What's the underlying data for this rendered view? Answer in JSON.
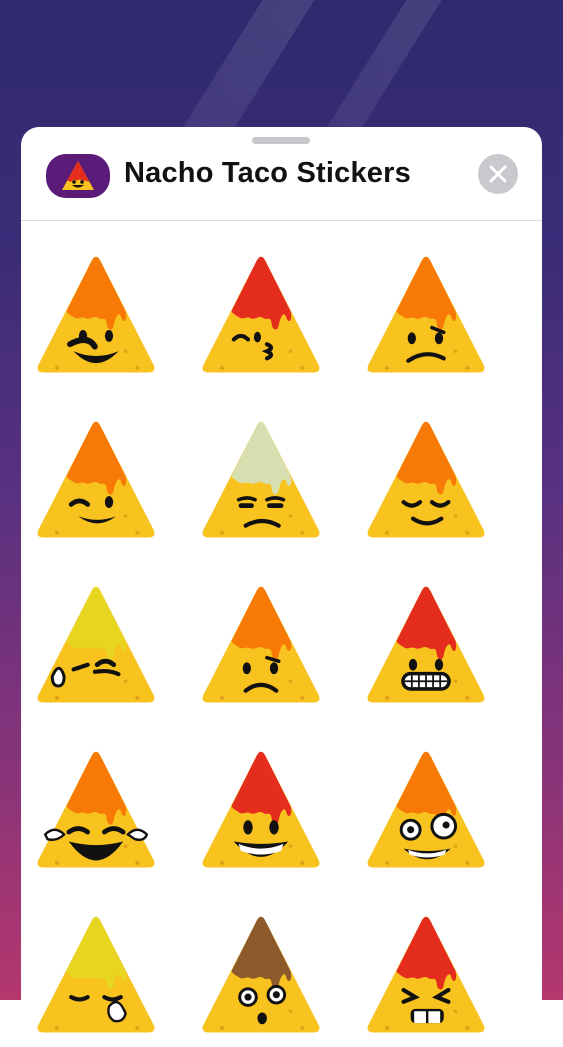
{
  "sheet": {
    "title": "Nacho Taco Stickers",
    "app_icon": "nacho-sticker-icon",
    "close_icon": "close-icon"
  },
  "colors": {
    "chip": "#f8c21f",
    "chip_shadow": "#e0a315",
    "orange": "#f77a07",
    "red": "#e42d1c",
    "yellow": "#e7d520",
    "cream": "#d7dfb1",
    "brown": "#8d5a2b",
    "close_bg": "#c8c8cd",
    "icon_bg": "#5b1b78"
  },
  "stickers": [
    {
      "name": "nacho-grin-sticker",
      "sauce": "orange",
      "face": "grin"
    },
    {
      "name": "nacho-kiss-sticker",
      "sauce": "red",
      "face": "kiss"
    },
    {
      "name": "nacho-confused-sticker",
      "sauce": "orange",
      "face": "confused"
    },
    {
      "name": "nacho-wink-sticker",
      "sauce": "orange",
      "face": "wink"
    },
    {
      "name": "nacho-unamused-sticker",
      "sauce": "cream",
      "face": "unamused"
    },
    {
      "name": "nacho-relieved-sticker",
      "sauce": "orange",
      "face": "relieved"
    },
    {
      "name": "nacho-sweat-sticker",
      "sauce": "yellow",
      "face": "sweat"
    },
    {
      "name": "nacho-frown-sticker",
      "sauce": "orange",
      "face": "frown"
    },
    {
      "name": "nacho-grimace-sticker",
      "sauce": "red",
      "face": "grimace"
    },
    {
      "name": "nacho-tears-of-joy-sticker",
      "sauce": "orange",
      "face": "joy"
    },
    {
      "name": "nacho-big-grin-sticker",
      "sauce": "red",
      "face": "biggrin"
    },
    {
      "name": "nacho-zany-sticker",
      "sauce": "orange",
      "face": "zany"
    },
    {
      "name": "nacho-crying-sticker",
      "sauce": "yellow",
      "face": "cry"
    },
    {
      "name": "nacho-surprised-sticker",
      "sauce": "brown",
      "face": "surprised"
    },
    {
      "name": "nacho-squint-sticker",
      "sauce": "red",
      "face": "squint"
    }
  ]
}
